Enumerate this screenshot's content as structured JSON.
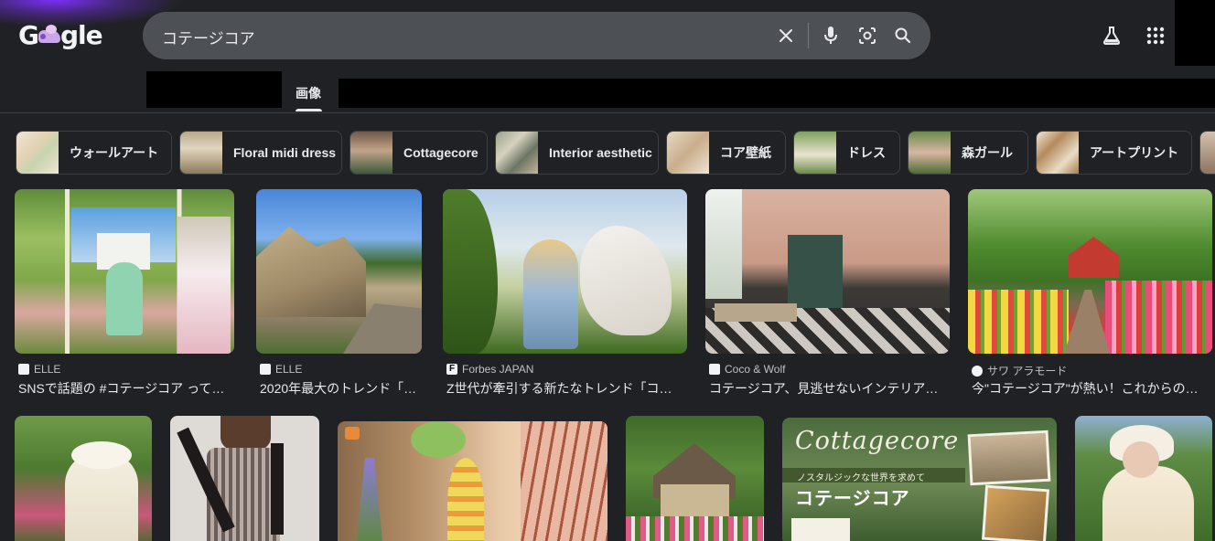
{
  "logo": {
    "text_left": "G",
    "text_right": "gle"
  },
  "search": {
    "query": "コテージコア"
  },
  "tabs": {
    "images": "画像"
  },
  "chips": [
    {
      "label": "ウォールアート"
    },
    {
      "label": "Floral midi dress"
    },
    {
      "label": "Cottagecore"
    },
    {
      "label": "Interior aesthetic"
    },
    {
      "label": "コア壁紙"
    },
    {
      "label": "ドレス"
    },
    {
      "label": "森ガール"
    },
    {
      "label": "アートプリント"
    }
  ],
  "results": [
    {
      "source": "ELLE",
      "title": "SNSで話題の #コテージコア って…"
    },
    {
      "source": "ELLE",
      "title": "2020年最大のトレンド「…"
    },
    {
      "source": "Forbes JAPAN",
      "title": "Z世代が牽引する新たなトレンド「コ…"
    },
    {
      "source": "Coco & Wolf",
      "title": "コテージコア、見逃せないインテリア…"
    },
    {
      "source": "サワ アラモード",
      "title": "今\"コテージコア\"が熱い！これからの…"
    }
  ],
  "poster": {
    "script_title": "Cottagecore",
    "banner": "ノスタルジックな世界を求めて",
    "main_text": "コテージコア"
  },
  "colors": {
    "background": "#202124",
    "search_box": "#4d5156",
    "chip_border": "#3c4043",
    "text": "#e8eaed",
    "subtext": "#bdc1c6"
  }
}
